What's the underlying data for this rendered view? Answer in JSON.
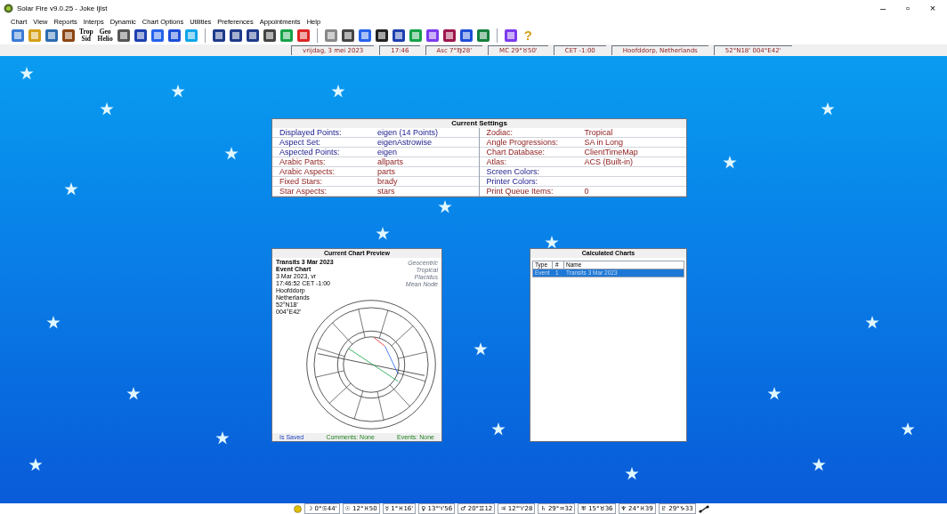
{
  "window": {
    "title": "Solar Fire v9.0.25  -  Joke Ijlst",
    "controls": [
      "–",
      "▫",
      "×"
    ]
  },
  "menu": [
    "Chart",
    "View",
    "Reports",
    "Interps",
    "Dynamic",
    "Chart Options",
    "Utilities",
    "Preferences",
    "Appointments",
    "Help"
  ],
  "toolbar_text_buttons": [
    {
      "top": "Trop",
      "bottom": "Sid"
    },
    {
      "top": "Geo",
      "bottom": "Helio"
    }
  ],
  "toolbar_help": "?",
  "info_bar": [
    "vrijdag, 3 mei 2023",
    "17:46",
    "Asc 7°♍28'",
    "MC 29°♉50'",
    "CET -1:00",
    "Hoofddorp, Netherlands",
    "52°N18'  004°E42'"
  ],
  "current_settings": {
    "title": "Current Settings",
    "left": [
      {
        "label": "Displayed Points:",
        "value": "eigen  (14 Points)",
        "kind": "points"
      },
      {
        "label": "Aspect Set:",
        "value": "eigenAstrowise",
        "kind": "points"
      },
      {
        "label": "Aspected Points:",
        "value": "eigen",
        "kind": "points"
      },
      {
        "label": "Arabic Parts:",
        "value": "allparts",
        "kind": "extras"
      },
      {
        "label": "Arabic Aspects:",
        "value": "parts",
        "kind": "extras"
      },
      {
        "label": "Fixed Stars:",
        "value": "brady",
        "kind": "extras"
      },
      {
        "label": "Star Aspects:",
        "value": "stars",
        "kind": "extras"
      }
    ],
    "right": [
      {
        "label": "Zodiac:",
        "value": "Tropical",
        "kind": "extras"
      },
      {
        "label": "Angle Progressions:",
        "value": "SA in Long",
        "kind": "extras"
      },
      {
        "label": "Chart Database:",
        "value": "ClientTimeMap",
        "kind": "extras"
      },
      {
        "label": "Atlas:",
        "value": "ACS  (Built-in)",
        "kind": "extras"
      },
      {
        "label": "Screen Colors:",
        "kind": "points"
      },
      {
        "label": "Printer Colors:",
        "kind": "points"
      },
      {
        "label": "Print Queue Items:",
        "value": "0",
        "kind": "extras"
      }
    ]
  },
  "chart_preview": {
    "title": "Current Chart Preview",
    "chart_title": "Transits 3 Mar 2023",
    "chart_type": "Event Chart",
    "details": [
      "3 Mar 2023, vr",
      "17:46:52  CET -1:00",
      "Hoofddorp",
      "Netherlands",
      "52°N18'",
      "004°E42'"
    ],
    "options": [
      "Geocentric",
      "Tropical",
      "Placidus",
      "Mean Node"
    ],
    "footer": [
      {
        "text": "Is Saved",
        "kind": "saved"
      },
      {
        "text": "Comments: None",
        "kind": "count"
      },
      {
        "text": "Events: None",
        "kind": "count"
      }
    ]
  },
  "calculated_charts": {
    "title": "Calculated Charts",
    "columns": [
      "Type",
      "#",
      "Name"
    ],
    "rows": [
      {
        "type": "Event",
        "number": "1",
        "name": "Transits 3 Mar 2023",
        "selected": true
      }
    ]
  },
  "status_bar": [
    "☽ 0°♋44'",
    "☉ 12°♓50",
    "☿ 1°♓16'",
    "♀ 13°♈56",
    "♂ 20°♊12",
    "♃ 12°♈28",
    "♄ 29°♒32",
    "♅ 15°♉36",
    "♆ 24°♓39",
    "♇ 29°♑33"
  ]
}
